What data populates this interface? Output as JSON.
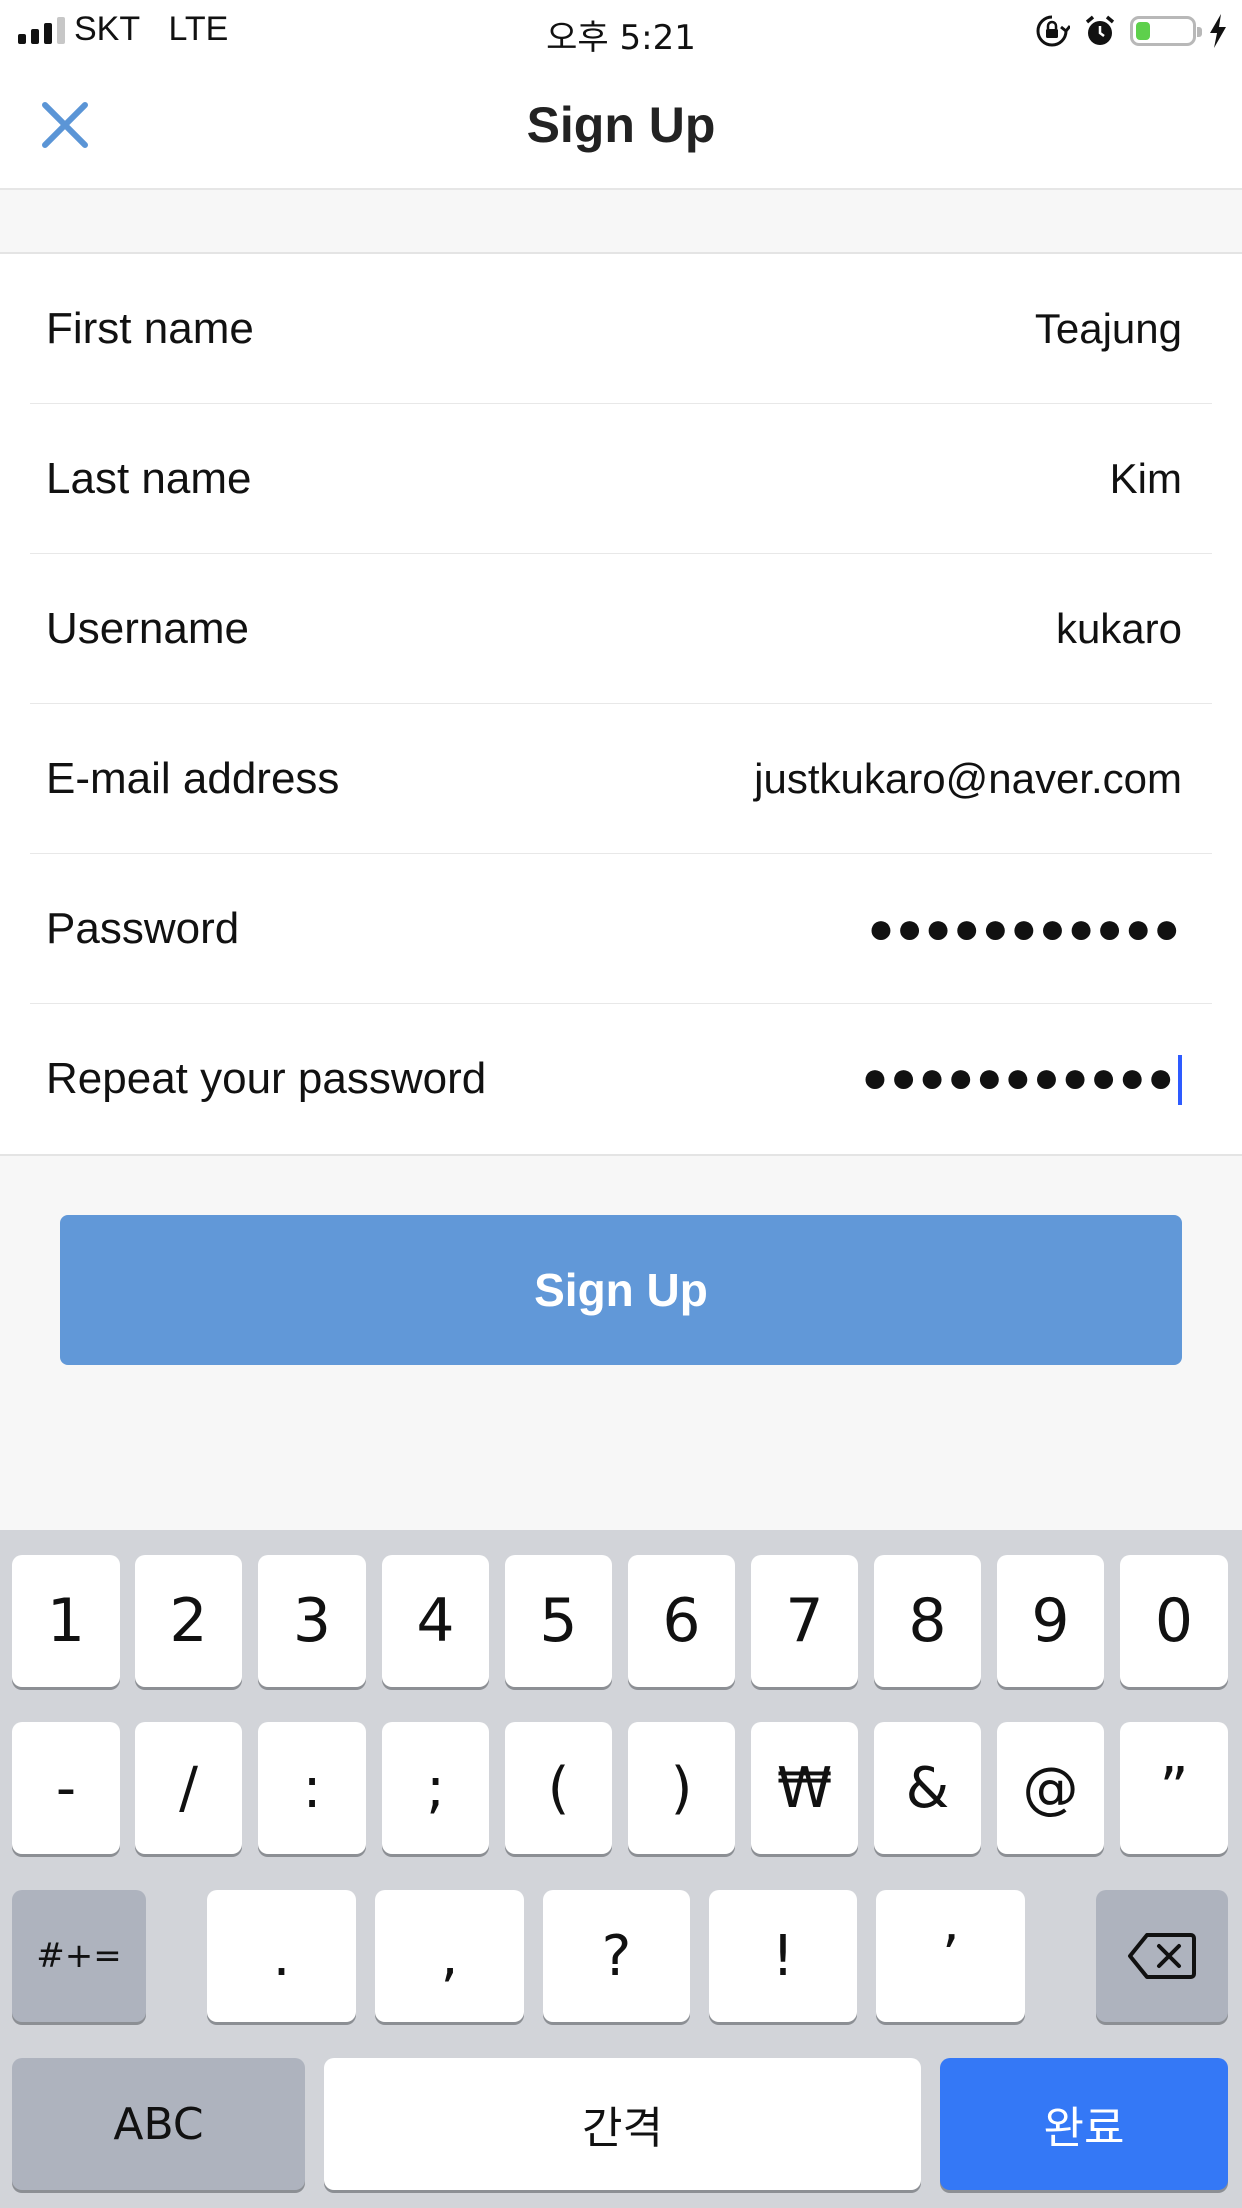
{
  "status_bar": {
    "carrier": "SKT",
    "network": "LTE",
    "time": "오후 5:21",
    "battery_level": 0.25,
    "icons": [
      "signal-icon",
      "orientation-lock-icon",
      "alarm-icon",
      "battery-icon",
      "charging-icon"
    ]
  },
  "nav": {
    "title": "Sign Up",
    "close_icon": "close-icon"
  },
  "form": {
    "fields": [
      {
        "label": "First name",
        "value": "Teajung"
      },
      {
        "label": "Last name",
        "value": "Kim"
      },
      {
        "label": "Username",
        "value": "kukaro"
      },
      {
        "label": "E-mail address",
        "value": "justkukaro@naver.com"
      },
      {
        "label": "Password",
        "value": "●●●●●●●●●●●"
      },
      {
        "label": "Repeat your password",
        "value": "●●●●●●●●●●●"
      }
    ]
  },
  "signup_button": {
    "label": "Sign Up"
  },
  "keyboard": {
    "row1": [
      "1",
      "2",
      "3",
      "4",
      "5",
      "6",
      "7",
      "8",
      "9",
      "0"
    ],
    "row2": [
      "-",
      "/",
      ":",
      ";",
      "(",
      ")",
      "₩",
      "&",
      "@",
      "”"
    ],
    "row3": [
      ".",
      ",",
      "?",
      "!",
      "’"
    ],
    "symbols_key": "#+=",
    "abc_key": "ABC",
    "space_key": "간격",
    "done_key": "완료",
    "delete_icon": "backspace-icon"
  },
  "colors": {
    "accent": "#6198d8",
    "close_icon": "#5b95d6",
    "done_key": "#3478f6",
    "caret": "#2e5bff"
  }
}
